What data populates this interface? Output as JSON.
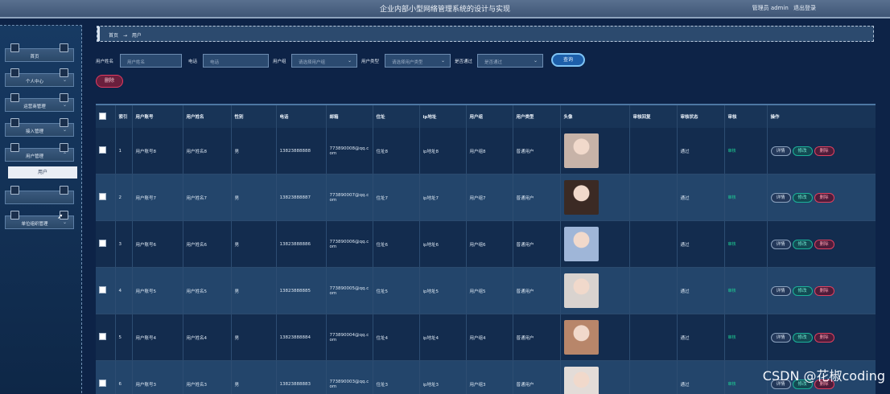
{
  "header": {
    "title": "企业内部小型网络管理系统的设计与实现",
    "admin_label": "管理员 admin",
    "logout_label": "退出登录"
  },
  "sidebar": {
    "items": [
      {
        "label": "首页",
        "chevron": ""
      },
      {
        "label": "个人中心",
        "chevron": "⌄"
      },
      {
        "label": "运营商管理",
        "chevron": "⌄"
      },
      {
        "label": "接入管理",
        "chevron": "⌄"
      },
      {
        "label": "用户管理",
        "chevron": "⌃"
      },
      {
        "label": "",
        "chevron": ""
      },
      {
        "label": "单位组织管理",
        "chevron": "⌄"
      }
    ],
    "sub_item": "用户"
  },
  "breadcrumb": {
    "home": "首页",
    "sep": "→",
    "current": "用户"
  },
  "filters": {
    "account_label": "用户姓名",
    "account_placeholder": "用户姓名",
    "phone_label": "电话",
    "phone_placeholder": "电话",
    "group_label": "用户组",
    "group_placeholder": "请选择用户组",
    "type_label": "用户类型",
    "type_placeholder": "请选择用户类型",
    "approve_label": "是否通过",
    "approve_placeholder": "是否通过",
    "query": "查询"
  },
  "actions": {
    "delete": "删除"
  },
  "table": {
    "headers": [
      "",
      "索引",
      "用户账号",
      "用户姓名",
      "性别",
      "电话",
      "邮箱",
      "住址",
      "ip地址",
      "用户组",
      "用户类型",
      "头像",
      "审核回复",
      "审核状态",
      "审核",
      "操作"
    ],
    "ops": {
      "detail": "详情",
      "edit": "修改",
      "del": "删除"
    },
    "rows": [
      {
        "idx": "1",
        "account": "用户账号8",
        "name": "用户姓名8",
        "gender": "男",
        "phone": "13823888888",
        "email": "773890008@qq.com",
        "addr": "住址8",
        "ip": "ip地址8",
        "group": "用户组8",
        "type": "普通用户",
        "reply": "",
        "state": "通过",
        "audit": "审核",
        "avatar": "#c7b3a8"
      },
      {
        "idx": "2",
        "account": "用户账号7",
        "name": "用户姓名7",
        "gender": "男",
        "phone": "13823888887",
        "email": "773890007@qq.com",
        "addr": "住址7",
        "ip": "ip地址7",
        "group": "用户组7",
        "type": "普通用户",
        "reply": "",
        "state": "通过",
        "audit": "审核",
        "avatar": "#3b2a24"
      },
      {
        "idx": "3",
        "account": "用户账号6",
        "name": "用户姓名6",
        "gender": "男",
        "phone": "13823888886",
        "email": "773890006@qq.com",
        "addr": "住址6",
        "ip": "ip地址6",
        "group": "用户组6",
        "type": "普通用户",
        "reply": "",
        "state": "通过",
        "audit": "审核",
        "avatar": "#9fb6d8"
      },
      {
        "idx": "4",
        "account": "用户账号5",
        "name": "用户姓名5",
        "gender": "男",
        "phone": "13823888885",
        "email": "773890005@qq.com",
        "addr": "住址5",
        "ip": "ip地址5",
        "group": "用户组5",
        "type": "普通用户",
        "reply": "",
        "state": "通过",
        "audit": "审核",
        "avatar": "#d9d3cf"
      },
      {
        "idx": "5",
        "account": "用户账号4",
        "name": "用户姓名4",
        "gender": "男",
        "phone": "13823888884",
        "email": "773890004@qq.com",
        "addr": "住址4",
        "ip": "ip地址4",
        "group": "用户组4",
        "type": "普通用户",
        "reply": "",
        "state": "通过",
        "audit": "审核",
        "avatar": "#b8866a"
      },
      {
        "idx": "6",
        "account": "用户账号3",
        "name": "用户姓名3",
        "gender": "男",
        "phone": "13823888883",
        "email": "773890003@qq.com",
        "addr": "住址3",
        "ip": "ip地址3",
        "group": "用户组3",
        "type": "普通用户",
        "reply": "",
        "state": "通过",
        "audit": "审核",
        "avatar": "#e3dcd8"
      }
    ]
  },
  "watermark": "CSDN @花椒coding"
}
